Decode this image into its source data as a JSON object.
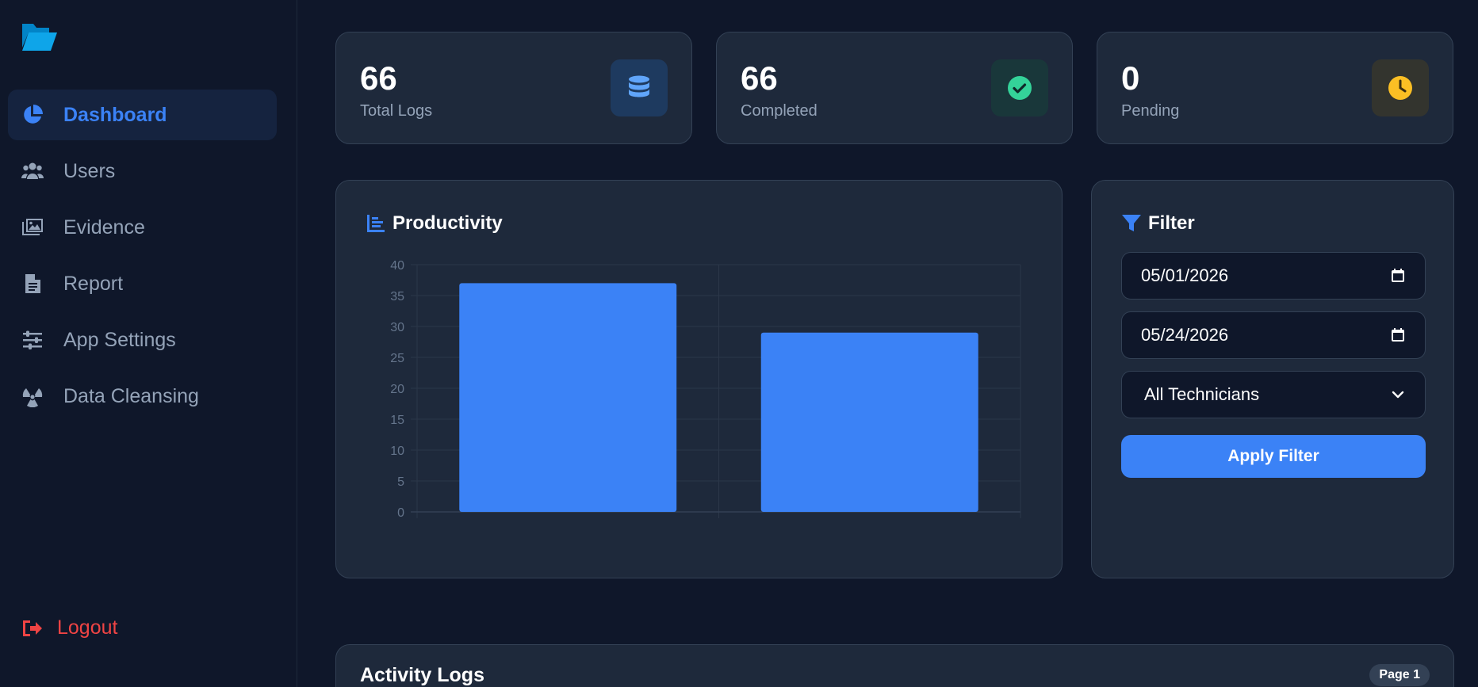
{
  "sidebar": {
    "logo_icon": "folder-open-icon",
    "items": [
      {
        "label": "Dashboard",
        "icon": "chart-pie-icon",
        "active": true
      },
      {
        "label": "Users",
        "icon": "users-icon",
        "active": false
      },
      {
        "label": "Evidence",
        "icon": "images-icon",
        "active": false
      },
      {
        "label": "Report",
        "icon": "file-lines-icon",
        "active": false
      },
      {
        "label": "App Settings",
        "icon": "sliders-icon",
        "active": false
      },
      {
        "label": "Data Cleansing",
        "icon": "radiation-icon",
        "active": false
      }
    ],
    "logout_label": "Logout"
  },
  "stats": [
    {
      "value": "66",
      "label": "Total Logs",
      "icon": "database-icon",
      "color": "#60a5fa"
    },
    {
      "value": "66",
      "label": "Completed",
      "icon": "check-circle-icon",
      "color": "#34d399"
    },
    {
      "value": "0",
      "label": "Pending",
      "icon": "clock-icon",
      "color": "#fbbf24"
    }
  ],
  "productivity": {
    "title": "Productivity"
  },
  "chart_data": {
    "type": "bar",
    "categories": [
      "",
      ""
    ],
    "values": [
      37,
      29
    ],
    "title": "Productivity",
    "xlabel": "",
    "ylabel": "",
    "ylim": [
      0,
      40
    ],
    "yticks": [
      0,
      5,
      10,
      15,
      20,
      25,
      30,
      35,
      40
    ],
    "grid": true,
    "bar_color": "#3b82f6"
  },
  "filter": {
    "title": "Filter",
    "start_date": "05/01/2026",
    "end_date": "05/24/2026",
    "technician_selected": "All Technicians",
    "apply_label": "Apply Filter"
  },
  "logs": {
    "title": "Activity Logs",
    "page_label": "Page 1"
  },
  "colors": {
    "accent": "#3b82f6",
    "background": "#0f172a",
    "card": "#1e293b",
    "danger": "#ef4444"
  }
}
